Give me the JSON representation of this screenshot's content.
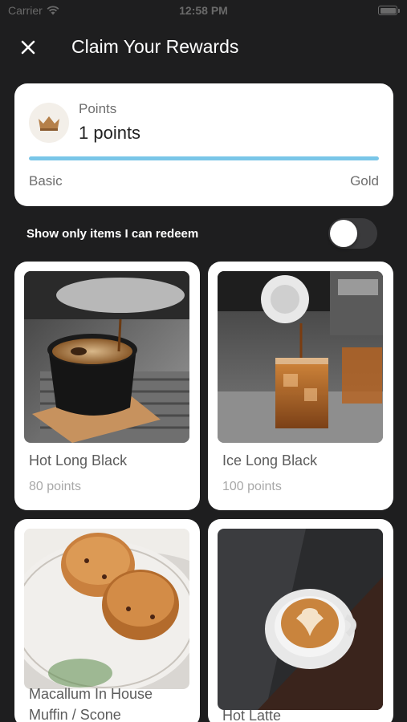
{
  "status_bar": {
    "carrier": "Carrier",
    "time": "12:58 PM"
  },
  "header": {
    "title": "Claim Your Rewards",
    "close_icon": "close-icon"
  },
  "points_card": {
    "label": "Points",
    "value": "1 points",
    "progress_fraction": 1.0,
    "tier_start": "Basic",
    "tier_end": "Gold",
    "icon": "crown-icon",
    "progress_color": "#79c6e8"
  },
  "filter": {
    "label": "Show only items I can redeem",
    "toggle_on": false
  },
  "rewards": [
    {
      "name": "Hot Long Black",
      "points": "80 points"
    },
    {
      "name": "Ice Long Black",
      "points": "100 points"
    },
    {
      "name": "Macallum In House Muffin / Scone",
      "points": ""
    },
    {
      "name": "Hot Latte",
      "points": ""
    }
  ]
}
